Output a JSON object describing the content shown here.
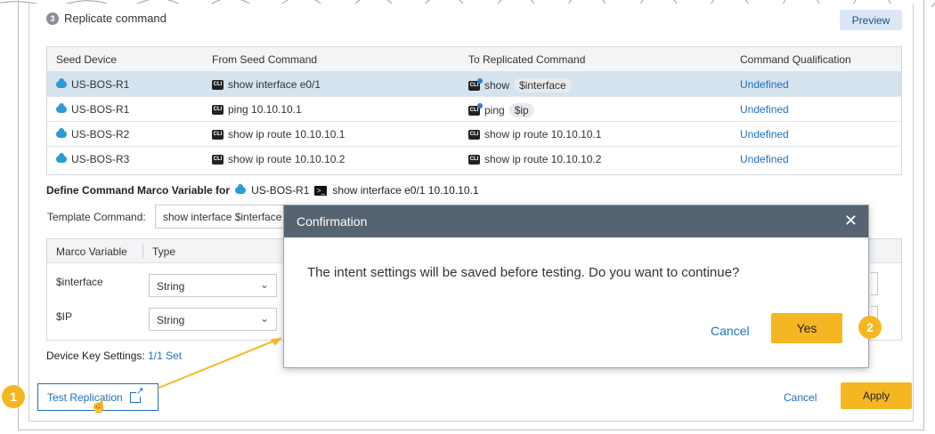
{
  "step": {
    "number": "3",
    "title": "Replicate command",
    "preview_label": "Preview"
  },
  "table": {
    "headers": [
      "Seed Device",
      "From Seed Command",
      "To Replicated Command",
      "Command Qualification"
    ],
    "rows": [
      {
        "device": "US-BOS-R1",
        "from": "show interface e0/1",
        "to_prefix": "show",
        "to_var": "$interface",
        "qualification": "Undefined",
        "selected": true
      },
      {
        "device": "US-BOS-R1",
        "from": "ping 10.10.10.1",
        "to_prefix": "ping",
        "to_var": "$ip",
        "qualification": "Undefined",
        "selected": false
      },
      {
        "device": "US-BOS-R2",
        "from": "show ip route 10.10.10.1",
        "to_prefix": "show ip route 10.10.10.1",
        "to_var": "",
        "qualification": "Undefined",
        "selected": false
      },
      {
        "device": "US-BOS-R3",
        "from": "show ip route 10.10.10.2",
        "to_prefix": "show ip route 10.10.10.2",
        "to_var": "",
        "qualification": "Undefined",
        "selected": false
      }
    ]
  },
  "define": {
    "label": "Define Command Marco Variable for",
    "device": "US-BOS-R1",
    "command": "show interface e0/1 10.10.10.1"
  },
  "template": {
    "label": "Template Command:",
    "value": "show interface $interface"
  },
  "macro_table": {
    "headers": [
      "Marco Variable",
      "Type"
    ],
    "rows": [
      {
        "name": "$interface",
        "type": "String"
      },
      {
        "name": "$IP",
        "type": "String"
      }
    ]
  },
  "device_key": {
    "label": "Device Key Settings:",
    "value": "1/1 Set"
  },
  "footer": {
    "test_label": "Test Replication",
    "cancel_label": "Cancel",
    "apply_label": "Apply"
  },
  "dialog": {
    "title": "Confirmation",
    "message": "The intent settings will be saved before testing. Do you want to continue?",
    "cancel_label": "Cancel",
    "yes_label": "Yes"
  },
  "callouts": [
    "1",
    "2"
  ],
  "colors": {
    "accent": "#f4b722",
    "link": "#1f6fc1",
    "dialog_header": "#566471",
    "selected_row": "#d5e3ee"
  }
}
